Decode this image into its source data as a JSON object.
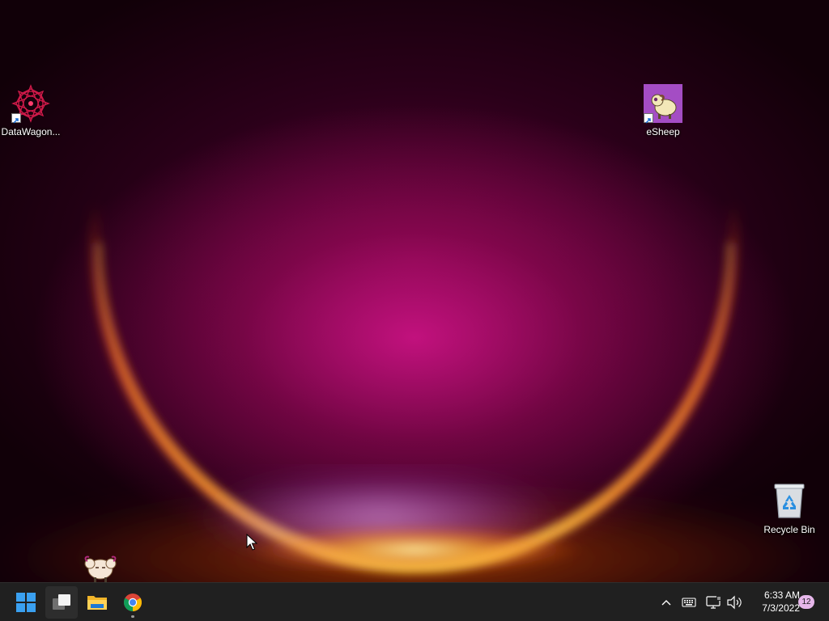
{
  "desktop": {
    "icons": [
      {
        "label": "DataWagon...",
        "icon": "datawagon-mandala-icon",
        "shortcut": true
      },
      {
        "label": "eSheep",
        "icon": "esheep-icon",
        "shortcut": true
      },
      {
        "label": "Recycle Bin",
        "icon": "recycle-bin-icon",
        "shortcut": false
      }
    ],
    "overlay_pet": "esheep-sprite",
    "wallpaper_colors": {
      "dark": "#110008",
      "magenta": "#d7148c",
      "orange": "#ff6a1a",
      "yellow": "#ffd23a",
      "violet": "#c77dff"
    }
  },
  "taskbar": {
    "background": "#202020",
    "pinned": [
      {
        "name": "start",
        "icon": "windows-logo-icon"
      },
      {
        "name": "task-view",
        "icon": "task-view-icon"
      },
      {
        "name": "file-explorer",
        "icon": "folder-icon"
      },
      {
        "name": "chrome",
        "icon": "chrome-icon",
        "running": true
      }
    ],
    "tray": {
      "icons": [
        "chevron-up-icon",
        "keyboard-icon",
        "network-icon",
        "volume-icon"
      ],
      "time": "6:33 AM",
      "date": "7/3/2022",
      "notification_count": "12",
      "badge_color": "#e6b7ea"
    }
  }
}
